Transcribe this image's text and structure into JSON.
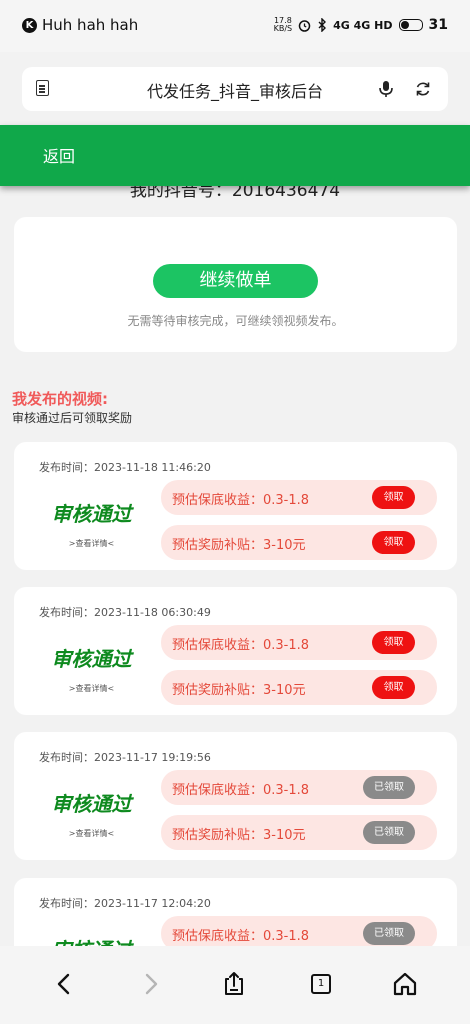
{
  "status_bar": {
    "app_name": "Huh hah hah",
    "speed_top": "17.8",
    "speed_bottom": "KB/S",
    "network": "4G 4G HD",
    "battery": "31"
  },
  "browser": {
    "page_title": "代发任务_抖音_审核后台"
  },
  "app_bar": {
    "back_label": "返回"
  },
  "partial_text": "我的抖音号：2016436474",
  "continue_card": {
    "button_label": "继续做单",
    "note": "无需等待审核完成，可继续领视频发布。"
  },
  "videos_section": {
    "title": "我发布的视频:",
    "subtitle": "审核通过后可领取奖励"
  },
  "videos": [
    {
      "time": "发布时间：2023-11-18 11:46:20",
      "status": "审核通过",
      "details": ">查看详情<",
      "income_label": "预估保底收益：0.3-1.8",
      "income_button": "领取",
      "subsidy_label": "预估奖励补贴：3-10元",
      "subsidy_button": "领取"
    },
    {
      "time": "发布时间：2023-11-18 06:30:49",
      "status": "审核通过",
      "details": ">查看详情<",
      "income_label": "预估保底收益：0.3-1.8",
      "income_button": "领取",
      "subsidy_label": "预估奖励补贴：3-10元",
      "subsidy_button": "领取"
    },
    {
      "time": "发布时间：2023-11-17 19:19:56",
      "status": "审核通过",
      "details": ">查看详情<",
      "income_label": "预估保底收益：0.3-1.8",
      "income_button": "已领取",
      "subsidy_label": "预估奖励补贴：3-10元",
      "subsidy_button": "已领取"
    },
    {
      "time": "发布时间：2023-11-17 12:04:20",
      "status": "审核通过",
      "income_label": "预估保底收益：0.3-1.8",
      "income_button": "已领取"
    }
  ],
  "bottom_nav": {
    "tab_count": "1"
  },
  "colors": {
    "app_bar": "#10a84a",
    "continue_button": "#1cc463",
    "approved_text": "#0e8a1f",
    "claim_button": "#ee1212",
    "claimed_button": "#8a8a8a",
    "pill_background": "#fde6e3",
    "pill_text": "#e4493a",
    "section_title": "#f05a5a"
  },
  "icons": [
    "k-app-icon",
    "alarm-icon",
    "bluetooth-icon",
    "signal-icon",
    "battery-icon",
    "page-doc-icon",
    "mic-icon",
    "reload-icon",
    "back-arrow-icon",
    "forward-arrow-icon",
    "share-icon",
    "tabs-icon",
    "home-icon"
  ]
}
